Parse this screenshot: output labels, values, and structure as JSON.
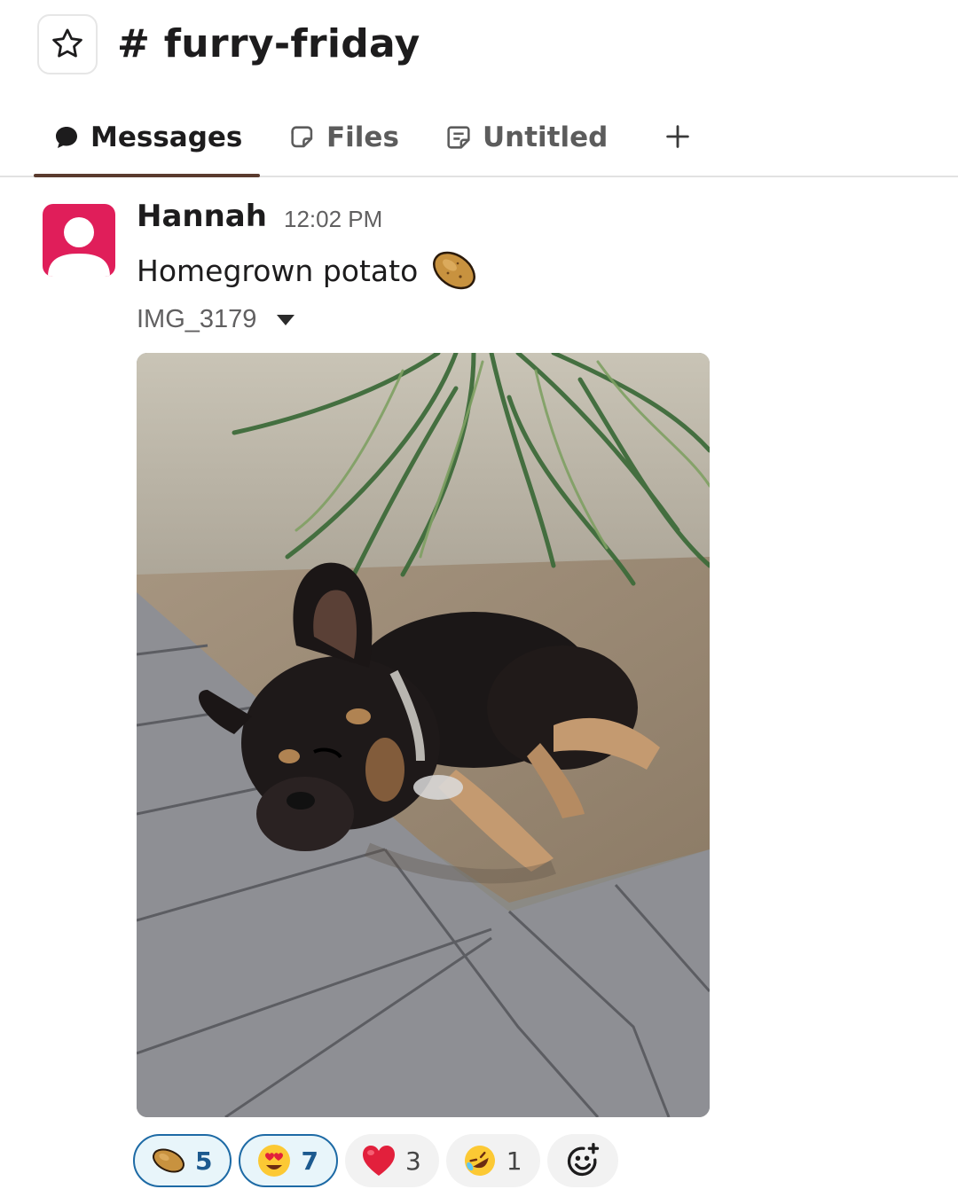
{
  "channel": {
    "star_icon": "star-outline-icon",
    "title": "# furry-friday"
  },
  "tabs": [
    {
      "label": "Messages",
      "icon": "message-bubble-icon",
      "active": true
    },
    {
      "label": "Files",
      "icon": "files-icon",
      "active": false
    },
    {
      "label": "Untitled",
      "icon": "canvas-doc-icon",
      "active": false
    }
  ],
  "add_tab_icon": "plus-icon",
  "message": {
    "author": "Hannah",
    "time": "12:02 PM",
    "text": "Homegrown potato",
    "text_emoji": "potato",
    "attachment": {
      "filename": "IMG_3179",
      "toggle_icon": "caret-down-icon",
      "image": "photo of a black and tan French bulldog lying in the dirt next to a brick paver path under palm fronds"
    }
  },
  "reactions": [
    {
      "emoji": "potato",
      "count": "5",
      "mine": true
    },
    {
      "emoji": "heart-eyes",
      "count": "7",
      "mine": true
    },
    {
      "emoji": "red-heart",
      "count": "3",
      "mine": false
    },
    {
      "emoji": "rofl",
      "count": "1",
      "mine": false
    }
  ],
  "add_reaction_icon": "add-reaction-icon",
  "colors": {
    "accent_underline": "#5a3b2e",
    "avatar_bg": "#e01e5a",
    "reaction_mine_border": "#1d6aa5",
    "reaction_mine_bg": "#e8f5fa"
  }
}
